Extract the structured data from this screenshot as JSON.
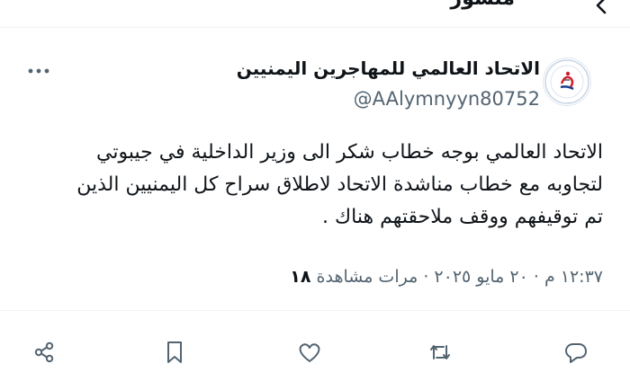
{
  "header": {
    "title": "منشور"
  },
  "tweet": {
    "author_name": "الاتحاد العالمي للمهاجرين اليمنيين",
    "author_handle": "@AAlymnyyn80752",
    "avatar_logo_text": "الاتحاد العالمي للمهاجرين اليمنيين",
    "text": "الاتحاد العالمي بوجه خطاب شكر الى وزير الداخلية في جيبوتي\nلتجاوبه مع خطاب مناشدة الاتحاد لاطلاق سراح كل اليمنيين الذين\nتم توقيفهم ووقف ملاحقتهم هناك .",
    "time": "١٢:٣٧ م",
    "date": "٢٠ مايو ٢٠٢٥",
    "separator": "·",
    "views_count": "١٨",
    "views_label": "مرات مشاهدة"
  },
  "icons": {
    "back": "chevron-left-icon",
    "more": "more-icon",
    "share": "share-icon",
    "bookmark": "bookmark-icon",
    "like": "heart-icon",
    "retweet": "retweet-icon",
    "reply": "reply-icon"
  },
  "colors": {
    "text": "#0f1419",
    "secondary": "#536471",
    "divider": "#eff3f4",
    "brand_red": "#d21f2c",
    "brand_blue": "#1a3e8c"
  }
}
